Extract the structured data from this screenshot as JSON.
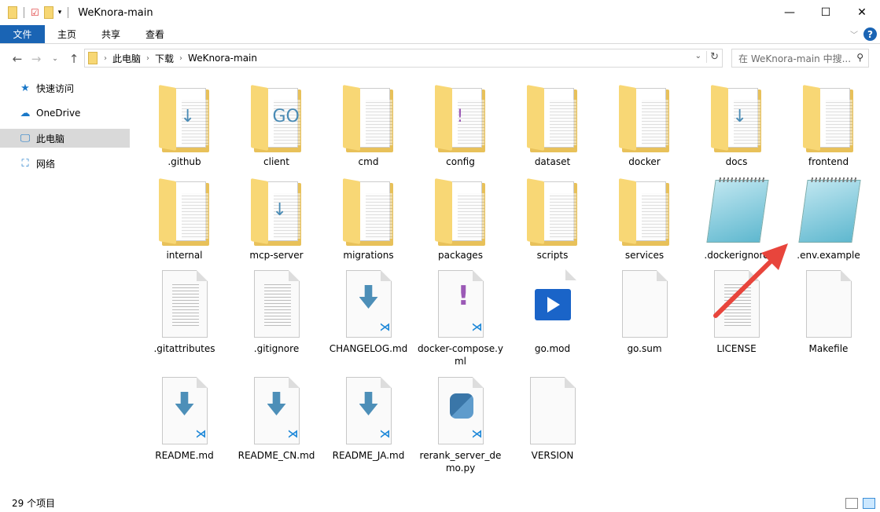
{
  "window": {
    "title": "WeKnora-main",
    "controls": [
      "minimize",
      "maximize",
      "close"
    ]
  },
  "ribbon": {
    "tabs": [
      "文件",
      "主页",
      "共享",
      "查看"
    ]
  },
  "address": {
    "crumbs": [
      "此电脑",
      "下载",
      "WeKnora-main"
    ]
  },
  "search": {
    "placeholder": "在 WeKnora-main 中搜..."
  },
  "sidebar": {
    "items": [
      {
        "label": "快速访问",
        "icon": "star-icon"
      },
      {
        "label": "OneDrive",
        "icon": "cloud-icon"
      },
      {
        "label": "此电脑",
        "icon": "computer-icon",
        "selected": true
      },
      {
        "label": "网络",
        "icon": "network-icon"
      }
    ]
  },
  "files": [
    {
      "name": ".github",
      "type": "folder",
      "mark": "↓"
    },
    {
      "name": "client",
      "type": "folder",
      "mark": "GO"
    },
    {
      "name": "cmd",
      "type": "folder",
      "mark": ""
    },
    {
      "name": "config",
      "type": "folder",
      "mark": "!"
    },
    {
      "name": "dataset",
      "type": "folder",
      "mark": ""
    },
    {
      "name": "docker",
      "type": "folder",
      "mark": ""
    },
    {
      "name": "docs",
      "type": "folder",
      "mark": "↓"
    },
    {
      "name": "frontend",
      "type": "folder",
      "mark": ""
    },
    {
      "name": "internal",
      "type": "folder",
      "mark": ""
    },
    {
      "name": "mcp-server",
      "type": "folder",
      "mark": "↓"
    },
    {
      "name": "migrations",
      "type": "folder",
      "mark": ""
    },
    {
      "name": "packages",
      "type": "folder",
      "mark": ""
    },
    {
      "name": "scripts",
      "type": "folder",
      "mark": ""
    },
    {
      "name": "services",
      "type": "folder",
      "mark": ""
    },
    {
      "name": ".dockerignore",
      "type": "notepad"
    },
    {
      "name": ".env.example",
      "type": "notepad"
    },
    {
      "name": ".gitattributes",
      "type": "text"
    },
    {
      "name": ".gitignore",
      "type": "text"
    },
    {
      "name": "CHANGELOG.md",
      "type": "vscode-md"
    },
    {
      "name": "docker-compose.yml",
      "type": "yaml"
    },
    {
      "name": "go.mod",
      "type": "gomod"
    },
    {
      "name": "go.sum",
      "type": "blank"
    },
    {
      "name": "LICENSE",
      "type": "text"
    },
    {
      "name": "Makefile",
      "type": "blank"
    },
    {
      "name": "README.md",
      "type": "vscode-md"
    },
    {
      "name": "README_CN.md",
      "type": "vscode-md"
    },
    {
      "name": "README_JA.md",
      "type": "vscode-md"
    },
    {
      "name": "rerank_server_demo.py",
      "type": "python"
    },
    {
      "name": "VERSION",
      "type": "blank"
    }
  ],
  "status": {
    "count": "29 个项目"
  },
  "annotation": {
    "arrow_color": "#e8453c",
    "points_to": ".env.example"
  },
  "colors": {
    "accent": "#1a64b4",
    "folder": "#f8d775"
  }
}
